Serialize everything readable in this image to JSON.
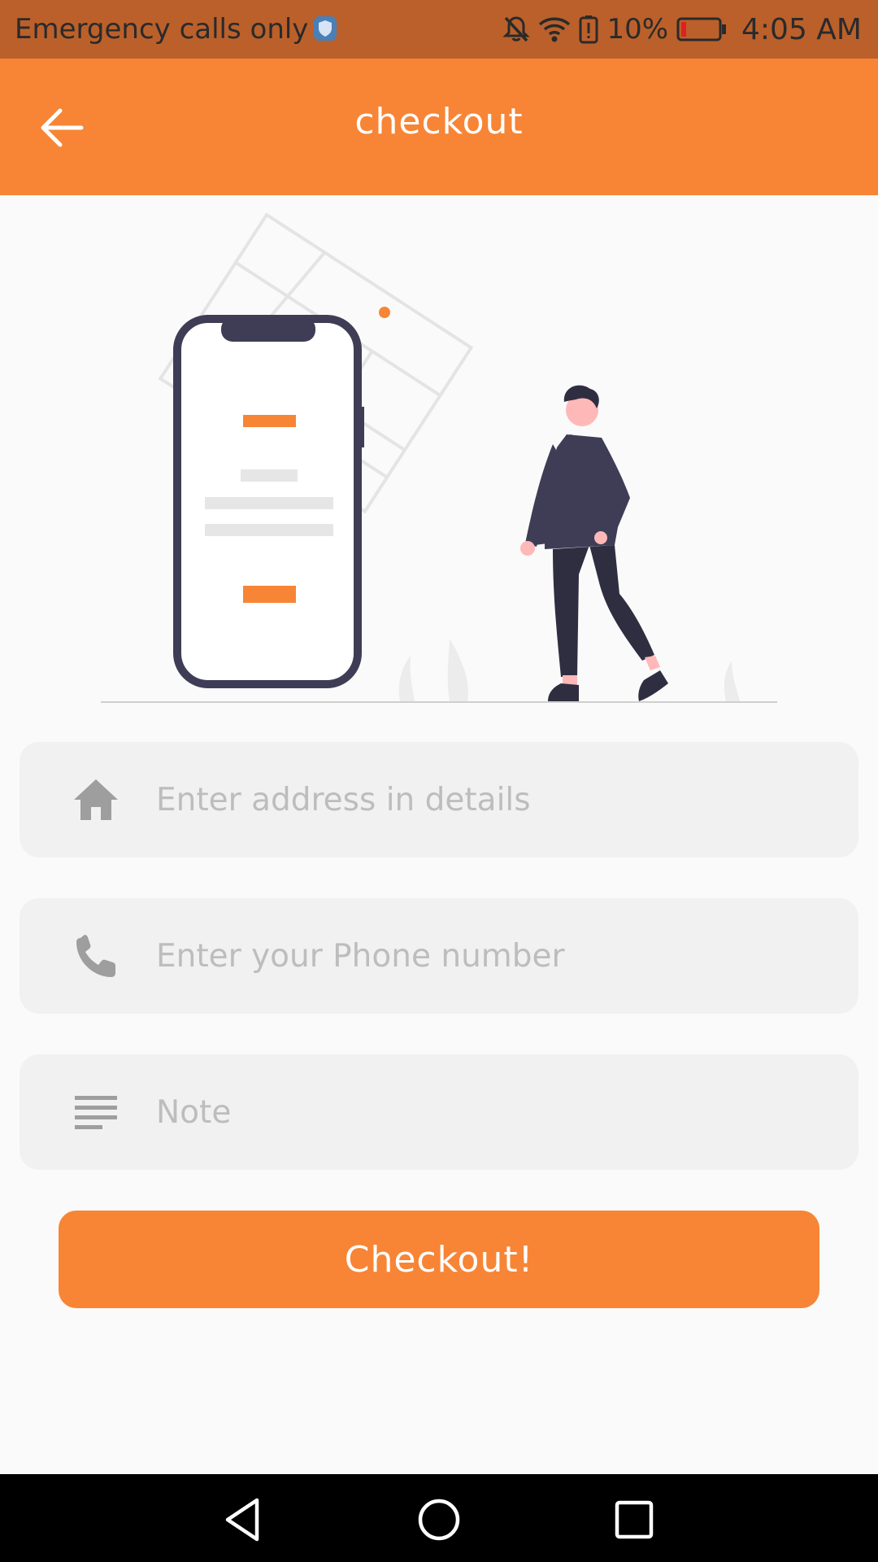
{
  "status_bar": {
    "carrier_text": "Emergency calls only",
    "battery_percent": "10%",
    "time": "4:05 AM",
    "icons": [
      "shield-icon",
      "mute-icon",
      "wifi-icon",
      "battery-alert-icon",
      "battery-icon"
    ]
  },
  "app_bar": {
    "title": "checkout",
    "back_icon": "arrow-back-icon"
  },
  "form": {
    "address": {
      "placeholder": "Enter address in details",
      "value": "",
      "icon": "home-icon"
    },
    "phone": {
      "placeholder": "Enter your Phone number",
      "value": "",
      "icon": "phone-icon"
    },
    "note": {
      "placeholder": "Note",
      "value": "",
      "icon": "notes-icon"
    }
  },
  "checkout_button": {
    "label": "Checkout!"
  },
  "nav_bar": {
    "icons": [
      "nav-back-icon",
      "nav-home-icon",
      "nav-recents-icon"
    ]
  },
  "colors": {
    "primary": "#f78535",
    "status_bar": "#bb602b",
    "field_background": "#f1f1f1",
    "placeholder": "#bdbdbd",
    "illustration_dark": "#3f3d56"
  }
}
